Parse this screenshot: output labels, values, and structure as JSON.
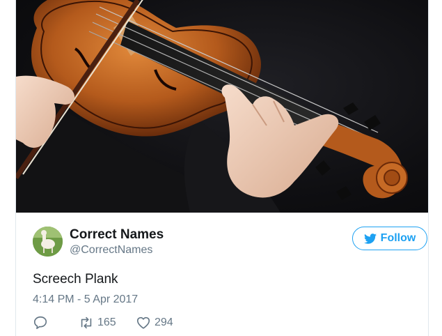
{
  "tweet": {
    "author_name": "Correct Names",
    "author_handle": "@CorrectNames",
    "text": "Screech Plank",
    "timestamp": "4:14 PM - 5 Apr 2017",
    "follow_label": "Follow",
    "retweet_count": "165",
    "like_count": "294"
  },
  "icons": {
    "avatar": "alpaca-avatar",
    "follow": "twitter-bird-icon",
    "reply": "reply-icon",
    "retweet": "retweet-icon",
    "like": "heart-icon"
  },
  "colors": {
    "accent": "#1da1f2",
    "secondary_text": "#657786",
    "primary_text": "#14171a"
  }
}
